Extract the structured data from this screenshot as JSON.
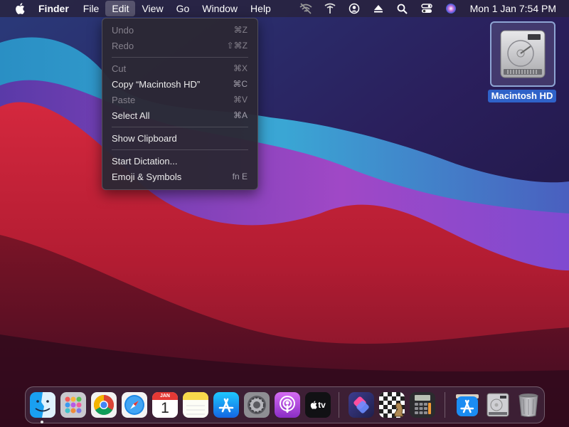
{
  "menubar": {
    "app_name": "Finder",
    "menus": [
      "File",
      "Edit",
      "View",
      "Go",
      "Window",
      "Help"
    ],
    "active_menu": "Edit",
    "clock": "Mon 1 Jan  7:54 PM",
    "status_icons": [
      "no-wifi-icon",
      "network-icon",
      "user-icon",
      "eject-icon",
      "search-icon",
      "control-center-icon",
      "siri-icon"
    ]
  },
  "edit_menu": {
    "items": [
      {
        "label": "Undo",
        "shortcut": "⌘Z",
        "enabled": false
      },
      {
        "label": "Redo",
        "shortcut": "⇧⌘Z",
        "enabled": false
      },
      {
        "label": "Cut",
        "shortcut": "⌘X",
        "enabled": false
      },
      {
        "label": "Copy “Macintosh HD”",
        "shortcut": "⌘C",
        "enabled": true
      },
      {
        "label": "Paste",
        "shortcut": "⌘V",
        "enabled": false
      },
      {
        "label": "Select All",
        "shortcut": "⌘A",
        "enabled": true
      },
      {
        "label": "Show Clipboard",
        "shortcut": "",
        "enabled": true
      },
      {
        "label": "Start Dictation...",
        "shortcut": "",
        "enabled": true
      },
      {
        "label": "Emoji & Symbols",
        "shortcut": "fn E",
        "enabled": true
      }
    ]
  },
  "desktop": {
    "drive_label": "Macintosh HD"
  },
  "dock": {
    "calendar_month": "JAN",
    "calendar_day": "1",
    "tv_label": "tv",
    "apps": [
      "finder",
      "launchpad",
      "chrome",
      "safari",
      "calendar",
      "notes",
      "app-store",
      "system-preferences",
      "podcasts",
      "apple-tv",
      "shortcuts",
      "chess",
      "calculator",
      "app-store-downloads",
      "macintosh-hd",
      "trash"
    ]
  },
  "colors": {
    "menu_highlight": "#5a5566",
    "selection_blue": "#2f62c9",
    "wallpaper_red": "#c0243c",
    "wallpaper_purple": "#7a3fb8"
  }
}
